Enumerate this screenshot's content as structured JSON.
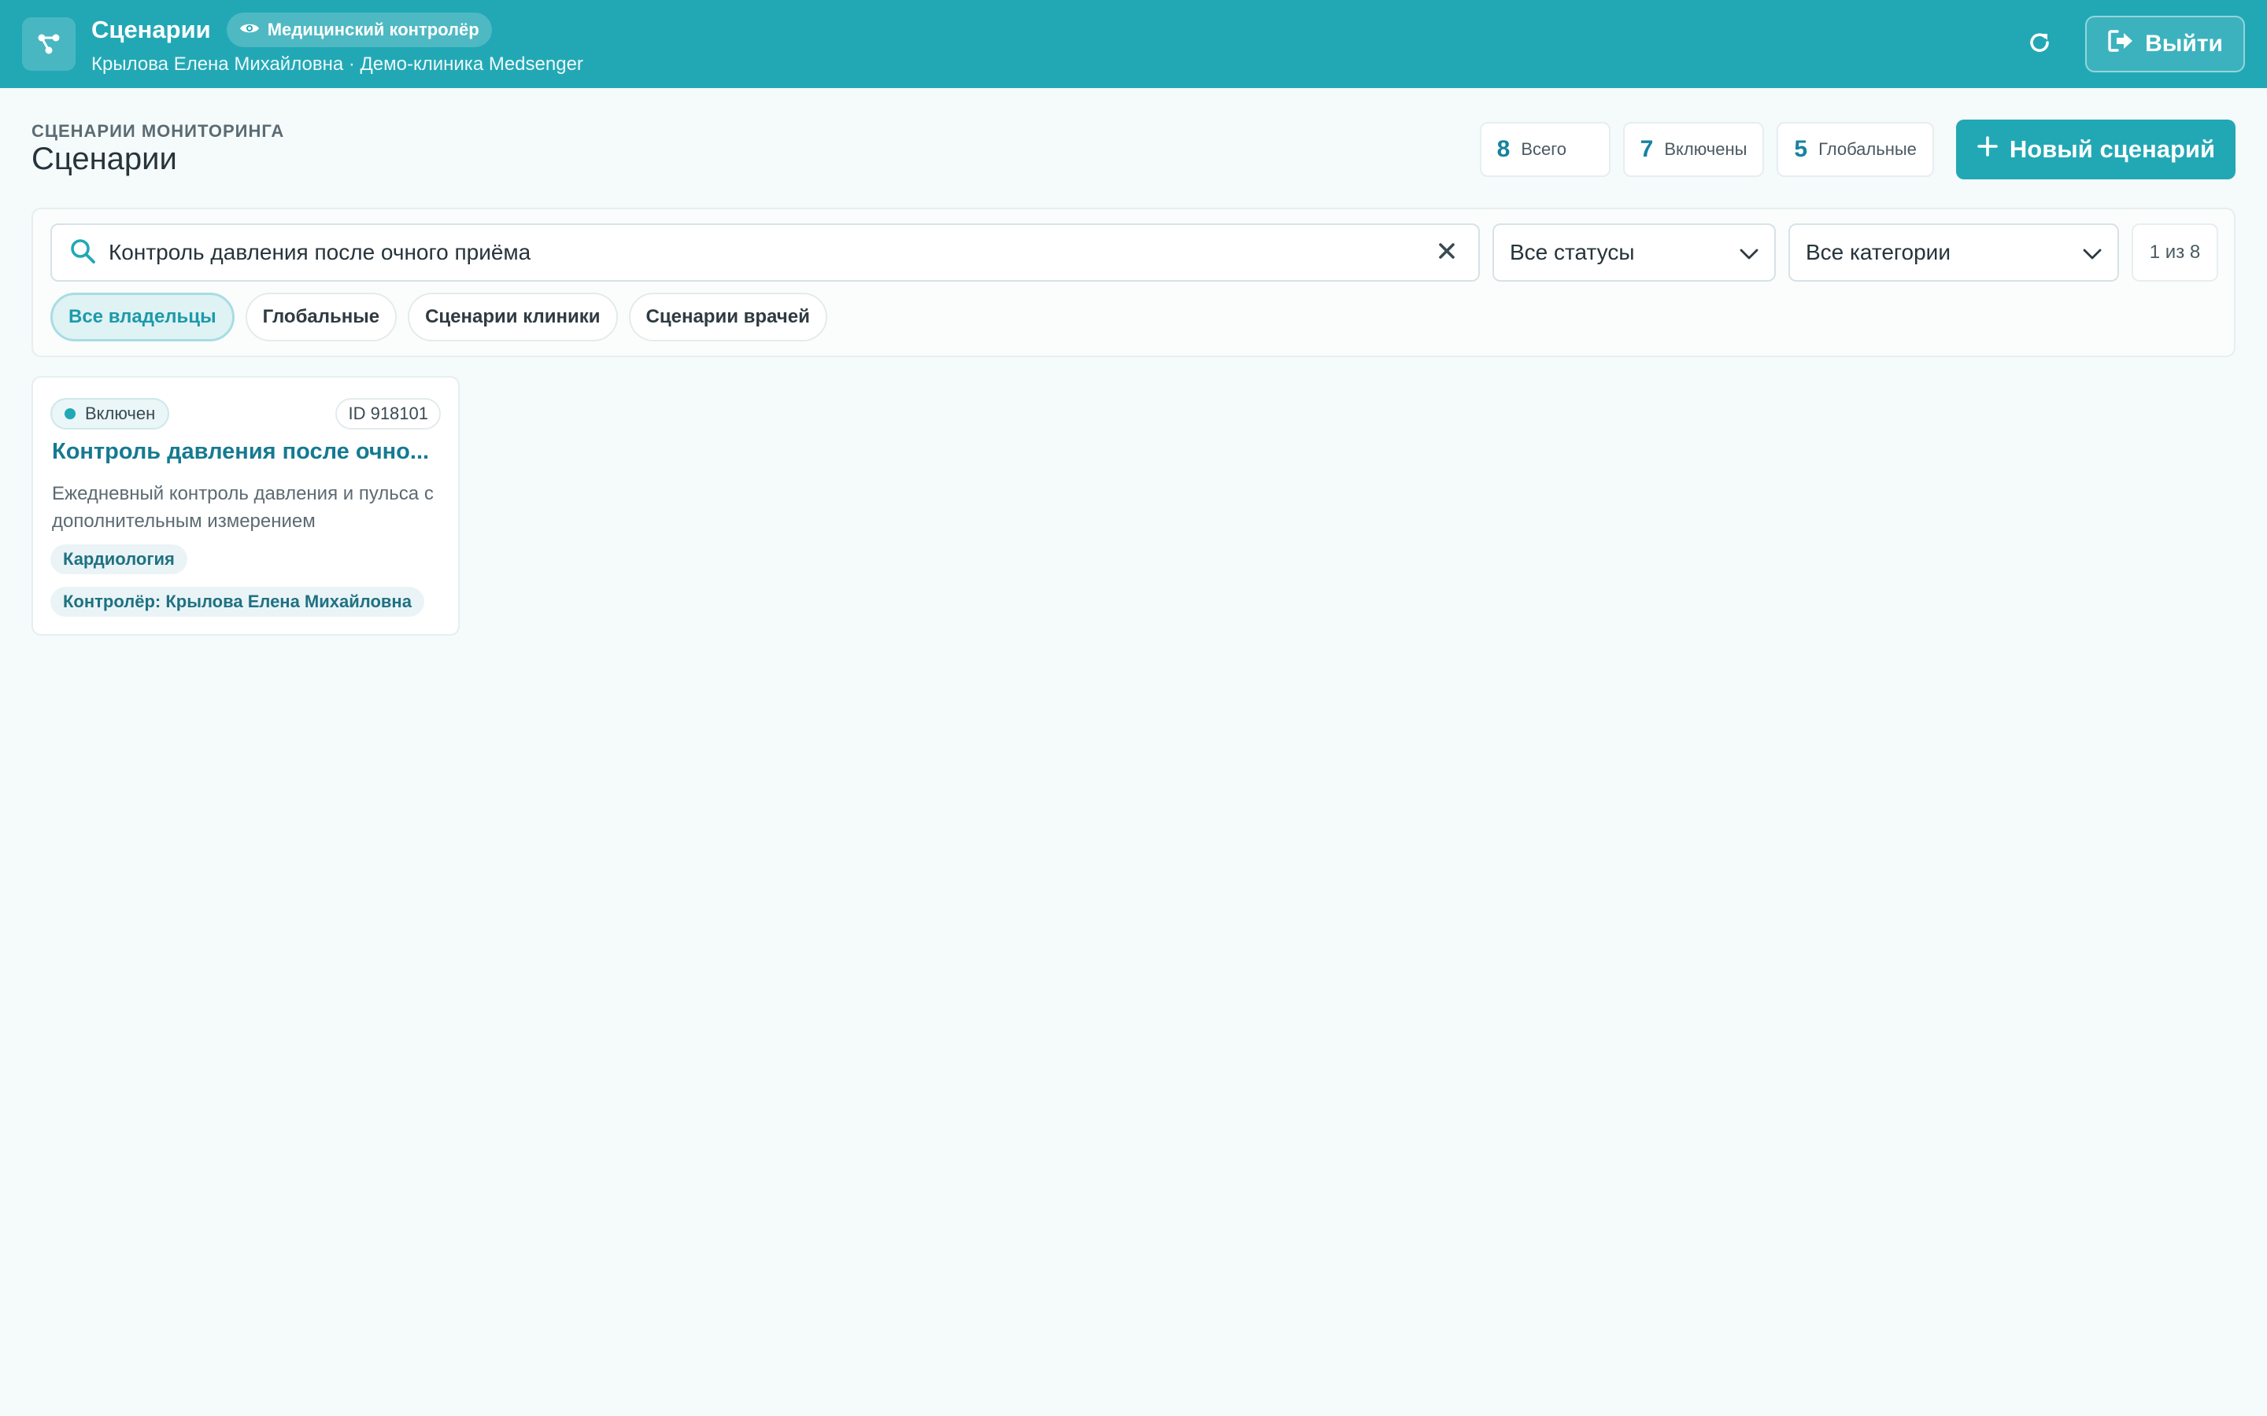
{
  "header": {
    "title": "Сценарии",
    "role_badge": "Медицинский контролёр",
    "user_line": "Крылова Елена Михайловна · Демо-клиника Medsenger",
    "logout_label": "Выйти",
    "brand_color": "#22a8b5"
  },
  "page": {
    "eyebrow": "СЦЕНАРИИ МОНИТОРИНГА",
    "title": "Сценарии",
    "stats": [
      {
        "value": "8",
        "label": "Всего"
      },
      {
        "value": "7",
        "label": "Включены"
      },
      {
        "value": "5",
        "label": "Глобальные"
      }
    ],
    "new_button_label": "Новый сценарий"
  },
  "filters": {
    "search_value": "Контроль давления после очного приёма",
    "status_select": "Все статусы",
    "category_select": "Все категории",
    "result_count": "1 из 8",
    "owner_chips": [
      "Все владельцы",
      "Глобальные",
      "Сценарии клиники",
      "Сценарии врачей"
    ],
    "active_chip": "Все владельцы"
  },
  "cards": [
    {
      "status": "Включен",
      "id": "ID 918101",
      "title": "Контроль давления после очно...",
      "description": "Ежедневный контроль давления и пульса с дополнительным измерением",
      "category": "Кардиология",
      "controller": "Контролёр: Крылова Елена Михайловна"
    }
  ],
  "icons": {
    "logo": "scenario-graph-icon",
    "role": "eye-icon",
    "refresh": "refresh-icon",
    "logout": "logout-icon",
    "add": "plus-icon",
    "search": "search-icon",
    "clear": "close-icon",
    "dropdown": "chevron-down-icon"
  }
}
